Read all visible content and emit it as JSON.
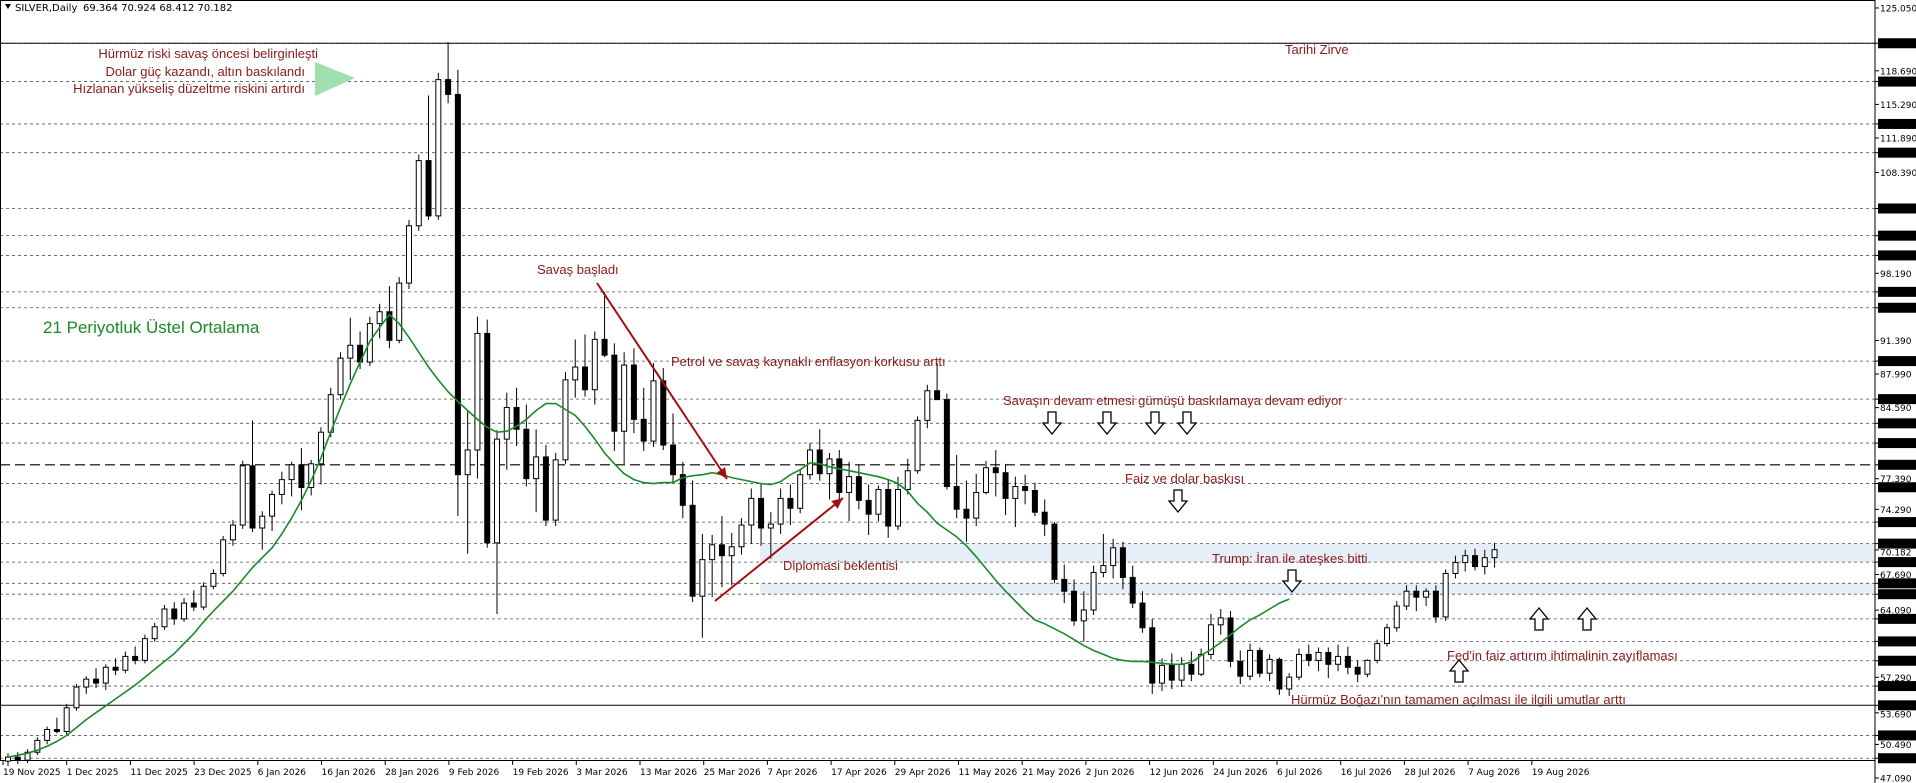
{
  "header": {
    "symbol": "SILVER,Daily",
    "ohlc": "69.364 70.924 68.412 70.182"
  },
  "chart_data": {
    "type": "candlestick",
    "symbol": "SILVER",
    "timeframe": "Daily",
    "ylim": [
      47.09,
      125.05
    ],
    "y_tick_labels": [
      "125.050",
      "121.480",
      "118.690",
      "117.600",
      "115.290",
      "113.310",
      "111.890",
      "110.400",
      "108.390",
      "104.750",
      "102.000",
      "100.000",
      "98.190",
      "96.310",
      "94.700",
      "91.390",
      "89.300",
      "87.990",
      "85.450",
      "84.590",
      "83.000",
      "81.000",
      "78.800",
      "77.390",
      "76.900",
      "74.290",
      "73.000",
      "70.820",
      "70.182",
      "68.950",
      "67.690",
      "66.800",
      "65.700",
      "64.090",
      "63.200",
      "60.920",
      "58.960",
      "57.290",
      "56.400",
      "54.450",
      "53.690",
      "51.400",
      "50.490",
      "49.090",
      "47.090"
    ],
    "highlighted_levels": [
      "121.480",
      "117.600",
      "113.310",
      "110.400",
      "104.750",
      "102.000",
      "100.000",
      "96.310",
      "94.700",
      "89.300",
      "85.450",
      "83.000",
      "81.000",
      "78.800",
      "76.900",
      "73.000",
      "70.820",
      "68.950",
      "66.800",
      "65.700",
      "63.200",
      "60.920",
      "58.960",
      "56.400",
      "54.450",
      "51.400",
      "49.090"
    ],
    "x_tick_labels": [
      "19 Nov 2025",
      "1 Dec 2025",
      "11 Dec 2025",
      "23 Dec 2025",
      "6 Jan 2026",
      "16 Jan 2026",
      "28 Jan 2026",
      "9 Feb 2026",
      "19 Feb 2026",
      "3 Mar 2026",
      "13 Mar 2026",
      "25 Mar 2026",
      "7 Apr 2026",
      "17 Apr 2026",
      "29 Apr 2026",
      "11 May 2026",
      "21 May 2026",
      "2 Jun 2026",
      "12 Jun 2026",
      "24 Jun 2026",
      "6 Jul 2026",
      "16 Jul 2026",
      "28 Jul 2026",
      "7 Aug 2026",
      "19 Aug 2026"
    ],
    "support_resistance": [
      121.48,
      117.6,
      113.31,
      110.4,
      104.75,
      102.0,
      100.0,
      96.31,
      94.7,
      89.3,
      85.45,
      83.0,
      81.0,
      76.9,
      73.0,
      70.82,
      68.95,
      66.8,
      65.7,
      63.2,
      60.92,
      58.96,
      56.4,
      51.4,
      49.09
    ],
    "dashed_level": 78.8,
    "solid_levels": [
      121.48,
      54.45
    ],
    "band_zones": [
      [
        68.95,
        70.82
      ],
      [
        65.7,
        66.8
      ]
    ],
    "ema": {
      "period": 21,
      "label": "21 Periyotluk Üstel Ortalama",
      "values": [
        49.2,
        49.4,
        49.6,
        49.9,
        50.3,
        50.8,
        51.4,
        52.2,
        53.0,
        53.7,
        54.4,
        55.1,
        55.8,
        56.5,
        57.3,
        58.1,
        58.9,
        59.7,
        60.7,
        61.7,
        62.9,
        64.0,
        65.0,
        66.0,
        67.2,
        68.4,
        69.4,
        70.4,
        71.8,
        73.4,
        75.2,
        77.2,
        79.5,
        82.1,
        84.6,
        87.0,
        89.2,
        91.3,
        92.7,
        94.0,
        93.1,
        91.7,
        90.2,
        88.7,
        87.4,
        86.2,
        85.2,
        84.3,
        83.4,
        82.6,
        82.1,
        82.2,
        82.7,
        83.4,
        84.3,
        85.0,
        85.0,
        84.4,
        83.8,
        82.7,
        81.4,
        80.0,
        78.9,
        77.9,
        77.3,
        77.0,
        76.9,
        77.0,
        77.0,
        77.5,
        77.7,
        77.8,
        78.0,
        77.8,
        77.5,
        77.3,
        77.1,
        76.9,
        76.8,
        77.1,
        77.8,
        78.3,
        79.0,
        78.9,
        78.6,
        78.4,
        78.2,
        78.0,
        77.8,
        77.6,
        77.3,
        76.9,
        76.1,
        74.9,
        74.0,
        72.9,
        72.2,
        71.5,
        70.6,
        69.5,
        68.3,
        67.1,
        66.0,
        65.0,
        64.0,
        63.1,
        62.7,
        62.2,
        61.7,
        61.1,
        60.5,
        60.0,
        59.6,
        59.2,
        59.0,
        58.9,
        58.9,
        58.8,
        58.7,
        58.6,
        58.6,
        58.8,
        59.5,
        60.1,
        60.8,
        61.6,
        62.4,
        63.1,
        63.6,
        64.2,
        64.8,
        65.2
      ]
    },
    "candles_ohlc": [
      [
        48.8,
        49.6,
        48.3,
        49.2
      ],
      [
        49.2,
        49.7,
        48.5,
        48.9
      ],
      [
        48.9,
        50.0,
        48.6,
        49.7
      ],
      [
        49.7,
        51.2,
        49.4,
        50.9
      ],
      [
        50.9,
        52.3,
        50.5,
        52.0
      ],
      [
        52.0,
        53.2,
        51.6,
        51.8
      ],
      [
        51.8,
        54.6,
        51.5,
        54.2
      ],
      [
        54.2,
        56.6,
        53.9,
        56.3
      ],
      [
        56.3,
        57.4,
        55.6,
        57.1
      ],
      [
        57.1,
        58.2,
        56.2,
        56.7
      ],
      [
        56.7,
        58.6,
        56.0,
        58.3
      ],
      [
        58.3,
        59.2,
        57.5,
        58.0
      ],
      [
        58.0,
        59.9,
        57.7,
        59.4
      ],
      [
        59.4,
        60.4,
        58.6,
        59.0
      ],
      [
        59.0,
        61.6,
        58.7,
        61.2
      ],
      [
        61.2,
        62.8,
        60.9,
        62.4
      ],
      [
        62.4,
        64.6,
        62.1,
        64.2
      ],
      [
        64.2,
        64.9,
        62.6,
        63.2
      ],
      [
        63.2,
        65.3,
        62.9,
        64.8
      ],
      [
        64.8,
        66.1,
        64.0,
        64.4
      ],
      [
        64.4,
        66.9,
        64.1,
        66.5
      ],
      [
        66.5,
        68.2,
        66.2,
        67.8
      ],
      [
        67.8,
        71.6,
        67.5,
        71.2
      ],
      [
        71.2,
        73.2,
        70.6,
        72.7
      ],
      [
        72.7,
        79.2,
        72.3,
        78.7
      ],
      [
        78.7,
        83.3,
        72.0,
        72.4
      ],
      [
        72.4,
        74.1,
        70.2,
        73.6
      ],
      [
        73.6,
        76.2,
        72.1,
        75.8
      ],
      [
        75.8,
        78.1,
        74.8,
        77.3
      ],
      [
        77.3,
        79.1,
        75.6,
        78.8
      ],
      [
        78.8,
        80.5,
        74.2,
        76.5
      ],
      [
        76.5,
        79.3,
        75.7,
        78.9
      ],
      [
        78.9,
        82.6,
        76.8,
        82.1
      ],
      [
        82.1,
        86.6,
        81.6,
        85.9
      ],
      [
        85.9,
        90.2,
        85.4,
        89.6
      ],
      [
        89.6,
        93.7,
        87.4,
        90.9
      ],
      [
        90.9,
        92.3,
        88.5,
        89.2
      ],
      [
        89.2,
        93.8,
        88.8,
        93.1
      ],
      [
        93.1,
        95.1,
        91.6,
        94.3
      ],
      [
        94.3,
        96.9,
        90.6,
        91.4
      ],
      [
        91.4,
        97.8,
        91.1,
        97.2
      ],
      [
        97.2,
        103.6,
        96.6,
        103.0
      ],
      [
        103.0,
        110.2,
        102.5,
        109.6
      ],
      [
        109.6,
        116.2,
        103.6,
        104.0
      ],
      [
        104.0,
        118.5,
        103.6,
        117.8
      ],
      [
        117.8,
        121.6,
        115.4,
        116.3
      ],
      [
        116.3,
        118.8,
        73.6,
        77.8
      ],
      [
        77.8,
        84.2,
        69.8,
        80.3
      ],
      [
        80.3,
        93.8,
        77.4,
        92.1
      ],
      [
        92.1,
        93.5,
        70.4,
        70.9
      ],
      [
        70.9,
        82.3,
        63.7,
        81.4
      ],
      [
        81.4,
        86.1,
        78.3,
        84.6
      ],
      [
        84.6,
        86.6,
        80.7,
        82.4
      ],
      [
        82.4,
        84.9,
        76.6,
        77.4
      ],
      [
        77.4,
        82.4,
        74.0,
        79.6
      ],
      [
        79.6,
        80.8,
        72.6,
        73.2
      ],
      [
        73.2,
        80.0,
        72.6,
        79.3
      ],
      [
        79.3,
        88.2,
        78.9,
        87.4
      ],
      [
        87.4,
        91.5,
        85.6,
        88.7
      ],
      [
        88.7,
        92.0,
        85.7,
        86.4
      ],
      [
        86.4,
        92.3,
        84.9,
        91.5
      ],
      [
        91.5,
        96.3,
        89.7,
        89.9
      ],
      [
        89.9,
        91.1,
        80.2,
        82.2
      ],
      [
        82.2,
        90.2,
        78.9,
        88.9
      ],
      [
        88.9,
        90.6,
        82.0,
        83.4
      ],
      [
        83.4,
        86.6,
        80.2,
        81.2
      ],
      [
        81.2,
        89.1,
        80.6,
        87.3
      ],
      [
        87.3,
        88.6,
        80.3,
        80.8
      ],
      [
        80.8,
        84.0,
        77.0,
        77.8
      ],
      [
        77.8,
        79.1,
        73.4,
        74.7
      ],
      [
        74.7,
        77.2,
        64.9,
        65.5
      ],
      [
        65.5,
        71.8,
        61.3,
        69.2
      ],
      [
        69.2,
        71.7,
        65.4,
        70.7
      ],
      [
        70.7,
        73.6,
        66.4,
        69.6
      ],
      [
        69.6,
        71.9,
        66.6,
        70.5
      ],
      [
        70.5,
        73.4,
        69.7,
        72.7
      ],
      [
        72.7,
        76.4,
        70.8,
        75.4
      ],
      [
        75.4,
        76.9,
        70.6,
        72.4
      ],
      [
        72.4,
        74.0,
        69.3,
        72.8
      ],
      [
        72.8,
        76.4,
        71.8,
        75.4
      ],
      [
        75.4,
        76.8,
        72.7,
        74.4
      ],
      [
        74.4,
        78.3,
        73.9,
        77.8
      ],
      [
        77.8,
        81.0,
        77.3,
        80.3
      ],
      [
        80.3,
        82.4,
        77.2,
        77.9
      ],
      [
        77.9,
        80.0,
        75.3,
        79.4
      ],
      [
        79.4,
        80.3,
        75.0,
        76.0
      ],
      [
        76.0,
        79.1,
        73.1,
        77.6
      ],
      [
        77.6,
        78.8,
        74.3,
        75.2
      ],
      [
        75.2,
        76.8,
        71.7,
        73.8
      ],
      [
        73.8,
        76.7,
        73.1,
        76.3
      ],
      [
        76.3,
        77.3,
        71.4,
        72.6
      ],
      [
        72.6,
        77.6,
        72.2,
        76.3
      ],
      [
        76.3,
        79.4,
        75.8,
        78.2
      ],
      [
        78.2,
        83.7,
        77.9,
        83.3
      ],
      [
        83.3,
        86.9,
        82.5,
        86.3
      ],
      [
        86.3,
        89.1,
        85.8,
        85.4
      ],
      [
        85.4,
        86.0,
        76.3,
        76.6
      ],
      [
        76.6,
        79.8,
        73.4,
        74.3
      ],
      [
        74.3,
        77.2,
        71.0,
        73.4
      ],
      [
        73.4,
        77.9,
        72.6,
        76.0
      ],
      [
        76.0,
        79.2,
        75.8,
        78.5
      ],
      [
        78.5,
        80.3,
        75.6,
        78.0
      ],
      [
        78.0,
        78.9,
        73.7,
        75.4
      ],
      [
        75.4,
        77.6,
        72.5,
        76.6
      ],
      [
        76.6,
        77.8,
        74.8,
        76.2
      ],
      [
        76.2,
        77.0,
        73.6,
        74.0
      ],
      [
        74.0,
        75.3,
        71.6,
        72.8
      ],
      [
        72.8,
        73.0,
        66.8,
        67.2
      ],
      [
        67.2,
        68.7,
        64.8,
        66.0
      ],
      [
        66.0,
        67.2,
        62.5,
        63.0
      ],
      [
        63.0,
        66.0,
        60.9,
        64.1
      ],
      [
        64.1,
        68.6,
        63.6,
        67.9
      ],
      [
        67.9,
        71.8,
        67.4,
        68.6
      ],
      [
        68.6,
        71.3,
        67.3,
        70.4
      ],
      [
        70.4,
        71.0,
        66.2,
        67.4
      ],
      [
        67.4,
        68.6,
        64.3,
        64.8
      ],
      [
        64.8,
        66.0,
        61.8,
        62.3
      ],
      [
        62.3,
        63.2,
        55.6,
        56.7
      ],
      [
        56.7,
        59.2,
        55.9,
        58.5
      ],
      [
        58.5,
        59.7,
        56.1,
        57.0
      ],
      [
        57.0,
        59.3,
        56.3,
        58.6
      ],
      [
        58.6,
        59.9,
        56.9,
        57.6
      ],
      [
        57.6,
        60.2,
        57.4,
        59.6
      ],
      [
        59.6,
        63.7,
        59.1,
        62.6
      ],
      [
        62.6,
        64.2,
        61.6,
        63.3
      ],
      [
        63.3,
        64.0,
        58.3,
        58.9
      ],
      [
        58.9,
        60.0,
        56.6,
        57.4
      ],
      [
        57.4,
        60.7,
        57.0,
        60.0
      ],
      [
        60.0,
        60.3,
        57.3,
        57.7
      ],
      [
        57.7,
        59.6,
        56.9,
        59.1
      ],
      [
        59.1,
        59.3,
        55.5,
        56.1
      ],
      [
        56.1,
        57.7,
        55.4,
        57.3
      ],
      [
        57.3,
        60.2,
        57.0,
        59.6
      ],
      [
        59.6,
        60.6,
        58.4,
        59.0
      ],
      [
        59.0,
        60.3,
        57.9,
        59.8
      ],
      [
        59.8,
        60.3,
        57.2,
        58.6
      ],
      [
        58.6,
        60.6,
        57.9,
        59.4
      ],
      [
        59.4,
        60.4,
        57.6,
        58.3
      ],
      [
        58.3,
        59.0,
        56.8,
        57.6
      ],
      [
        57.6,
        59.1,
        57.3,
        59.0
      ],
      [
        59.0,
        61.1,
        58.7,
        60.7
      ],
      [
        60.7,
        62.7,
        60.4,
        62.3
      ],
      [
        62.3,
        65.0,
        61.9,
        64.5
      ],
      [
        64.5,
        66.6,
        64.1,
        66.0
      ],
      [
        66.0,
        66.6,
        64.0,
        65.4
      ],
      [
        65.4,
        66.3,
        64.5,
        66.0
      ],
      [
        66.0,
        66.6,
        62.8,
        63.4
      ],
      [
        63.4,
        68.2,
        63.0,
        67.8
      ],
      [
        67.8,
        69.6,
        67.3,
        68.9
      ],
      [
        68.9,
        70.2,
        68.0,
        69.6
      ],
      [
        69.6,
        70.3,
        68.1,
        68.5
      ],
      [
        68.5,
        70.2,
        67.7,
        69.4
      ],
      [
        69.4,
        70.9,
        68.4,
        70.2
      ]
    ],
    "annotations": [
      {
        "id": "hurmuz-risk",
        "text": "Hürmüz riski savaş öncesi belirginleşti"
      },
      {
        "id": "dollar",
        "text": "Dolar güç kazandı, altın baskılandı"
      },
      {
        "id": "correction",
        "text": "Hızlanan yükseliş düzeltme riskini artırdı"
      },
      {
        "id": "ath",
        "text": "Tarihi Zirve"
      },
      {
        "id": "war-start",
        "text": "Savaş başladı"
      },
      {
        "id": "oil-inflation",
        "text": "Petrol ve savaş kaynaklı enflasyon korkusu arttı"
      },
      {
        "id": "war-continue",
        "text": "Savaşın devam etmesi gümüşü baskılamaya devam ediyor"
      },
      {
        "id": "rate-dollar",
        "text": "Faiz ve dolar baskısı"
      },
      {
        "id": "trump",
        "text": "Trump: İran ile ateşkes bitti"
      },
      {
        "id": "diplomacy",
        "text": "Diplomasi beklentisi"
      },
      {
        "id": "fed",
        "text": "Fed'in faiz artırım ihtimalinin zayıflaması"
      },
      {
        "id": "hormuz-open",
        "text": "Hürmüz Boğazı'nın tamamen açılması ile ilgili umutlar arttı"
      }
    ],
    "colors": {
      "bull_fill": "#ffffff",
      "bear_fill": "#000000",
      "candle_stroke": "#000000",
      "ema": "#1a8a2a",
      "annotation": "#8b1a1a",
      "band": "#e6eef8",
      "arrow_fill": "#a0e0b0",
      "red_arrow": "#a01010"
    }
  }
}
